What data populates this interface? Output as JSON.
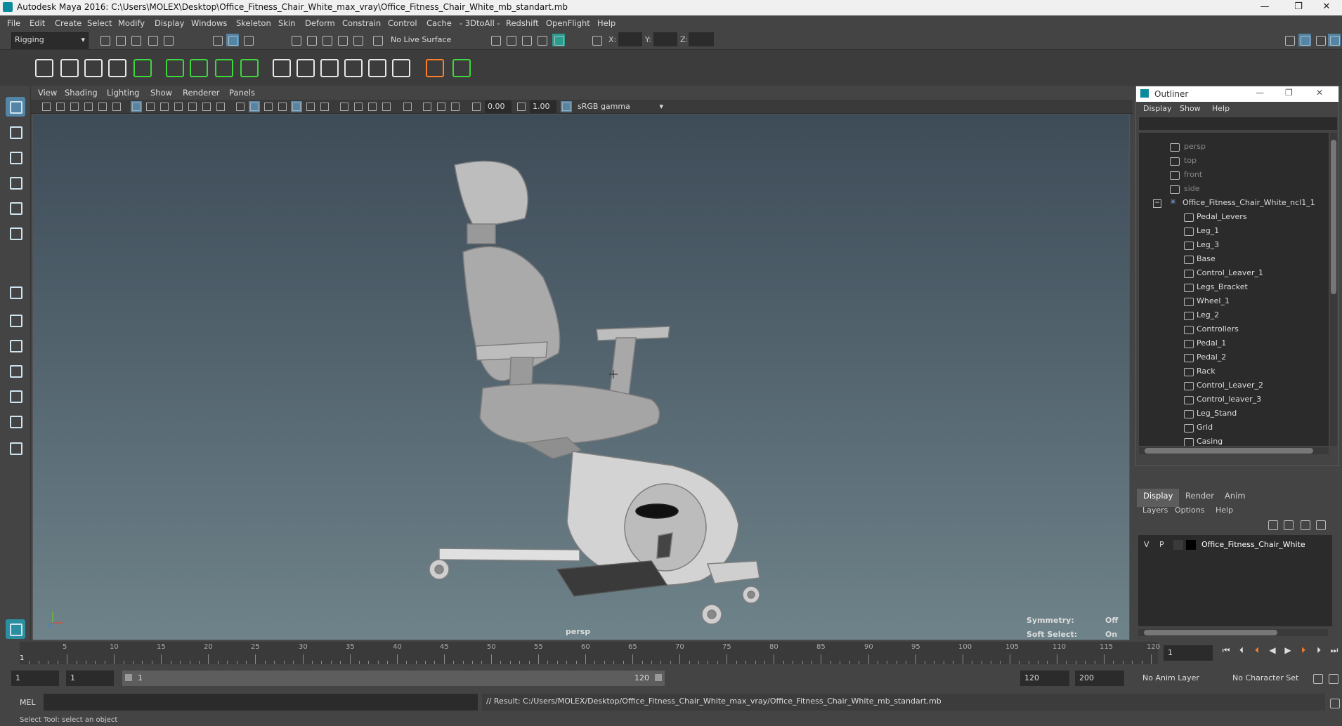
{
  "window": {
    "title": "Autodesk Maya 2016: C:\\Users\\MOLEX\\Desktop\\Office_Fitness_Chair_White_max_vray\\Office_Fitness_Chair_White_mb_standart.mb",
    "minimize": "—",
    "restore": "❐",
    "close": "✕"
  },
  "menubar": [
    "File",
    "Edit",
    "Create",
    "Select",
    "Modify",
    "Display",
    "Windows",
    "Skeleton",
    "Skin",
    "Deform",
    "Constrain",
    "Control",
    "Cache",
    "- 3DtoAll -",
    "Redshift",
    "OpenFlight",
    "Help"
  ],
  "status_line": {
    "mode": "Rigging",
    "live_surface": "No Live Surface",
    "x_label": "X:",
    "y_label": "Y:",
    "z_label": "Z:"
  },
  "panel": {
    "menus": [
      "View",
      "Shading",
      "Lighting",
      "Show",
      "Renderer",
      "Panels"
    ],
    "exposure": "0.00",
    "gamma": "1.00",
    "color_space": "sRGB gamma"
  },
  "viewport": {
    "camera_label": "persp",
    "symmetry_label": "Symmetry:",
    "symmetry_value": "Off",
    "soft_select_label": "Soft Select:",
    "soft_select_value": "On"
  },
  "outliner": {
    "title": "Outliner",
    "menus": [
      "Display",
      "Show",
      "Help"
    ],
    "cameras": [
      "persp",
      "top",
      "front",
      "side"
    ],
    "group": "Office_Fitness_Chair_White_ncl1_1",
    "children": [
      "Pedal_Levers",
      "Leg_1",
      "Leg_3",
      "Base",
      "Control_Leaver_1",
      "Legs_Bracket",
      "Wheel_1",
      "Leg_2",
      "Controllers",
      "Pedal_1",
      "Pedal_2",
      "Rack",
      "Control_Leaver_2",
      "Control_leaver_3",
      "Leg_Stand",
      "Grid",
      "Casing"
    ]
  },
  "layer_editor": {
    "tabs": [
      "Display",
      "Render",
      "Anim"
    ],
    "menus": [
      "Layers",
      "Options",
      "Help"
    ],
    "layer": {
      "v": "V",
      "p": "P",
      "name": "Office_Fitness_Chair_White"
    }
  },
  "timeline": {
    "ticks": [
      "5",
      "10",
      "15",
      "20",
      "25",
      "30",
      "35",
      "40",
      "45",
      "50",
      "55",
      "60",
      "65",
      "70",
      "75",
      "80",
      "85",
      "90",
      "95",
      "100",
      "105",
      "110",
      "115",
      "120"
    ],
    "start_marker": "1",
    "current_frame": "1"
  },
  "range": {
    "start": "1",
    "playback_start": "1",
    "slider_start": "1",
    "slider_end": "120",
    "playback_end": "120",
    "end": "200",
    "anim_layer": "No Anim Layer",
    "character_set": "No Character Set"
  },
  "command": {
    "lang": "MEL",
    "result": "// Result: C:/Users/MOLEX/Desktop/Office_Fitness_Chair_White_max_vray/Office_Fitness_Chair_White_mb_standart.mb"
  },
  "help_line": "Select Tool: select an object",
  "colors": {
    "accent": "#5285a6",
    "viewport_top": "#3e4c58",
    "viewport_bottom": "#6f838a",
    "shelf_green": "#3fd63f",
    "shelf_orange": "#ff7f27"
  }
}
